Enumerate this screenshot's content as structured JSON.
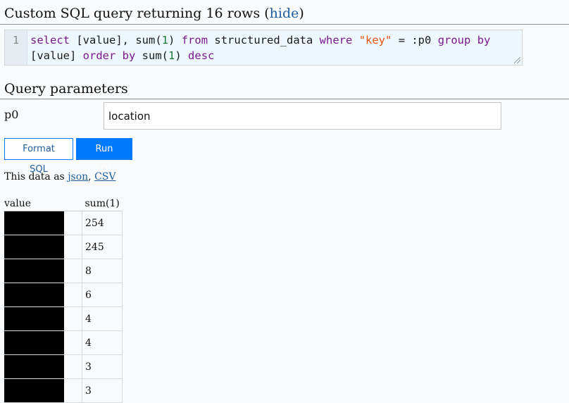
{
  "query_header": {
    "prefix": "Custom SQL query returning 16 rows (",
    "hide_link": "hide",
    "suffix": ")"
  },
  "editor": {
    "line_number": "1",
    "tokens": [
      {
        "t": "select",
        "c": "kw"
      },
      {
        "t": " [value], ",
        "c": ""
      },
      {
        "t": "sum",
        "c": ""
      },
      {
        "t": "(",
        "c": ""
      },
      {
        "t": "1",
        "c": "num"
      },
      {
        "t": ")",
        "c": ""
      },
      {
        "t": " ",
        "c": ""
      },
      {
        "t": "from",
        "c": "kw"
      },
      {
        "t": " structured_data ",
        "c": ""
      },
      {
        "t": "where",
        "c": "kw"
      },
      {
        "t": " ",
        "c": ""
      },
      {
        "t": "\"key\"",
        "c": "str"
      },
      {
        "t": " = :p0 ",
        "c": ""
      },
      {
        "t": "group",
        "c": "kw"
      },
      {
        "t": " ",
        "c": ""
      },
      {
        "t": "by",
        "c": "kw"
      },
      {
        "t": " [value] ",
        "c": ""
      },
      {
        "t": "order",
        "c": "kw"
      },
      {
        "t": " ",
        "c": ""
      },
      {
        "t": "by",
        "c": "kw"
      },
      {
        "t": " sum(",
        "c": ""
      },
      {
        "t": "1",
        "c": "num"
      },
      {
        "t": ") ",
        "c": ""
      },
      {
        "t": "desc",
        "c": "kw"
      }
    ]
  },
  "params": {
    "heading": "Query parameters",
    "p0_label": "p0",
    "p0_value": "location"
  },
  "buttons": {
    "format": "Format SQL",
    "run": "Run SQL"
  },
  "export": {
    "prefix": "This data as ",
    "json": "json",
    "sep": ", ",
    "csv": "CSV"
  },
  "table": {
    "headers": [
      "value",
      "sum(1)"
    ],
    "rows": [
      254,
      245,
      8,
      6,
      4,
      4,
      3,
      3
    ]
  }
}
